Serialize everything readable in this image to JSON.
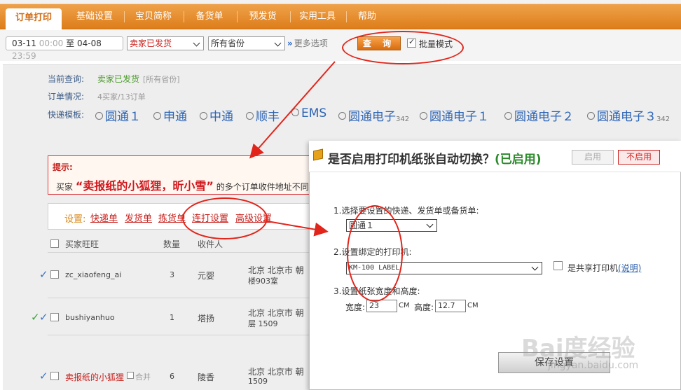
{
  "nav": {
    "tabs": [
      "订单打印",
      "基础设置",
      "宝贝简称",
      "备货单",
      "预发货",
      "实用工具",
      "帮助"
    ],
    "active_index": 0
  },
  "filter": {
    "date_from": "03-11",
    "time_from": "00:00",
    "to_label": "至",
    "date_to": "04-08",
    "time_to": "23:59",
    "status_select": "卖家已发货",
    "province_select": "所有省份",
    "more_options": "更多选项",
    "query_button": "查 询",
    "batch_mode_label": "批量模式",
    "batch_mode_checked": true
  },
  "summary": {
    "current_query_label": "当前查询:",
    "current_query_value": "卖家已发货",
    "current_query_note": "[所有省份]",
    "order_status_label": "订单情况:",
    "order_status_value": "4买家/13订单",
    "template_label": "快递模板:",
    "templates": [
      {
        "name": "圆通１",
        "sub": ""
      },
      {
        "name": "申通",
        "sub": ""
      },
      {
        "name": "中通",
        "sub": ""
      },
      {
        "name": "顺丰",
        "sub": ""
      },
      {
        "name": "EMS",
        "sub": ""
      },
      {
        "name": "圆通电子",
        "sub": "342"
      },
      {
        "name": "圆通电子１",
        "sub": ""
      },
      {
        "name": "圆通电子２",
        "sub": ""
      },
      {
        "name": "圆通电子３",
        "sub": "342"
      }
    ]
  },
  "hint": {
    "title": "提示:",
    "prefix": "买家",
    "buyers": "“卖报纸的小狐狸，昕小雪”",
    "suffix": "的多个订单收件地址不同"
  },
  "settings": {
    "label": "设置:",
    "links": [
      "快递单",
      "发货单",
      "拣货单",
      "连打设置",
      "高级设置"
    ]
  },
  "table": {
    "headers": [
      "买家旺旺",
      "数量",
      "收件人"
    ],
    "rows": [
      {
        "buyer": "zc_xiaofeng_ai",
        "qty": "3",
        "recipient": "元婴",
        "addr1": "北京  北京市  朝",
        "addr2": "楼903室"
      },
      {
        "buyer": "bushiyanhuo",
        "qty": "1",
        "recipient": "塔扬",
        "addr1": "北京  北京市  朝",
        "addr2": "层 1509"
      },
      {
        "buyer": "卖报纸的小狐狸",
        "qty": "6",
        "recipient": "陵香",
        "addr1": "北京  北京市  朝",
        "addr2": "1509",
        "merge": "合并"
      }
    ]
  },
  "dialog": {
    "title": "是否启用打印机纸张自动切换？",
    "status": "(已启用)",
    "enable_button": "启用",
    "disable_button": "不启用",
    "step1": "1.选择要设置的快递、发货单或备货单:",
    "step1_value": "圆通１",
    "step2": "2.设置绑定的打印机:",
    "step2_value": "KM-100 LABEL",
    "shared_printer_label": "是共享打印机",
    "shared_printer_help": "(说明)",
    "step3": "3.设置纸张宽度和高度:",
    "width_label": "宽度:",
    "width_value": "23",
    "height_label": "高度:",
    "height_value": "12.7",
    "unit": "CM",
    "save_button": "保存设置"
  },
  "watermark": {
    "brand": "Bai度经验",
    "url": "jingyan.baidu.com"
  }
}
